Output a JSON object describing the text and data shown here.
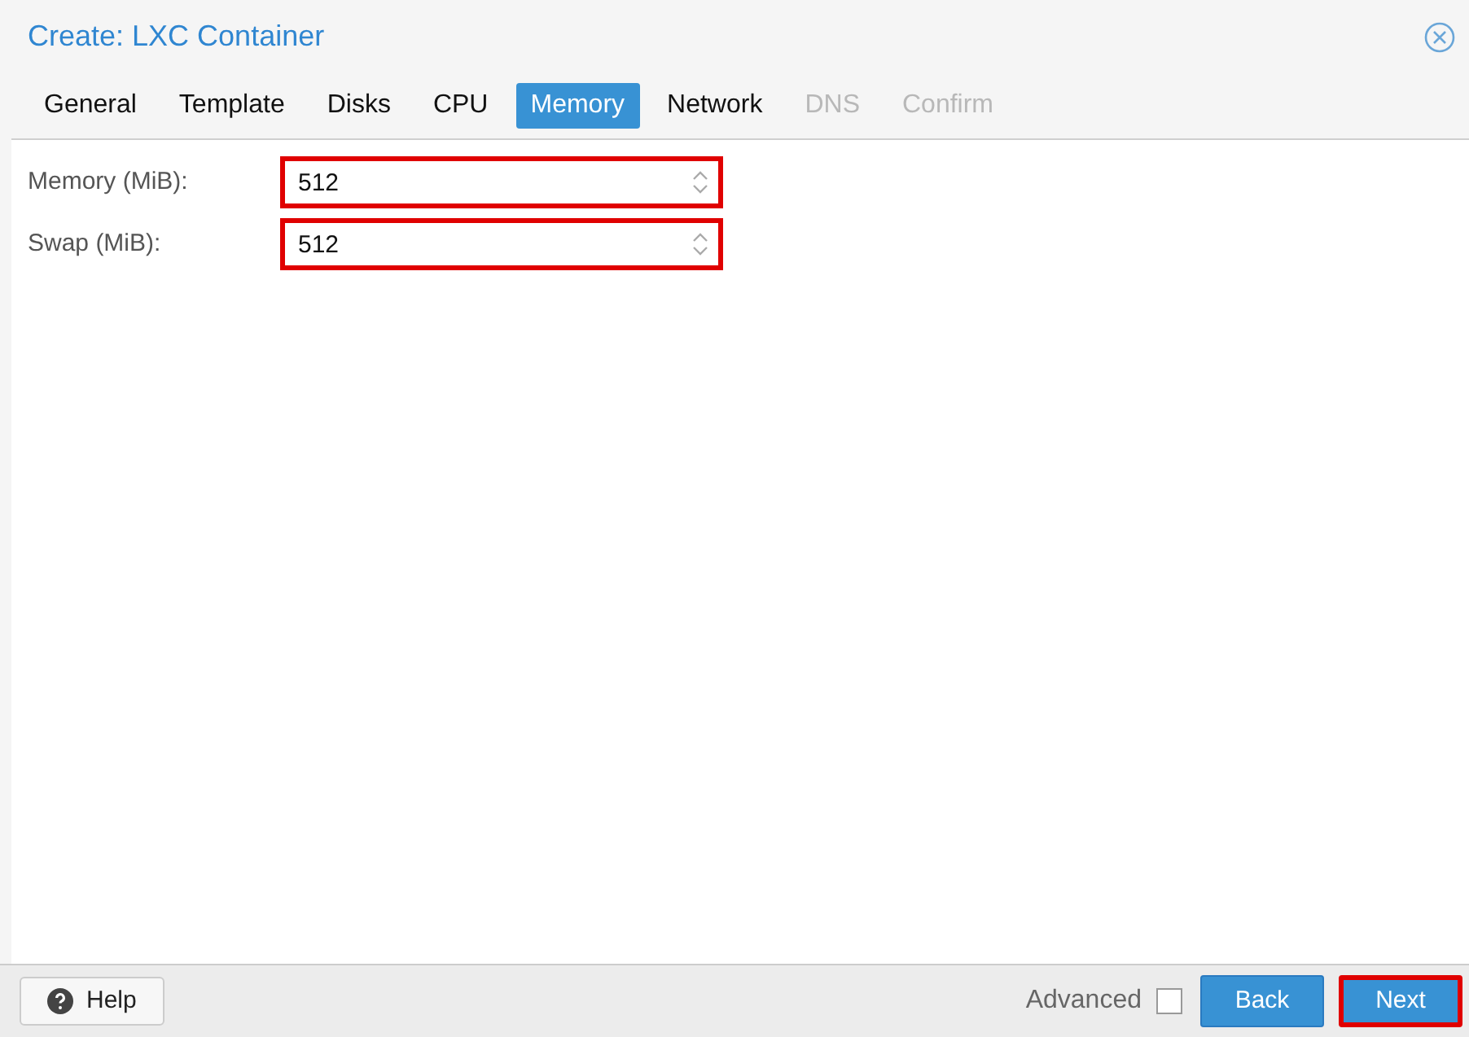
{
  "window": {
    "title": "Create: LXC Container"
  },
  "tabs": [
    {
      "label": "General",
      "selected": false,
      "disabled": false
    },
    {
      "label": "Template",
      "selected": false,
      "disabled": false
    },
    {
      "label": "Disks",
      "selected": false,
      "disabled": false
    },
    {
      "label": "CPU",
      "selected": false,
      "disabled": false
    },
    {
      "label": "Memory",
      "selected": true,
      "disabled": false
    },
    {
      "label": "Network",
      "selected": false,
      "disabled": false
    },
    {
      "label": "DNS",
      "selected": false,
      "disabled": true
    },
    {
      "label": "Confirm",
      "selected": false,
      "disabled": true
    }
  ],
  "fields": [
    {
      "label": "Memory (MiB):",
      "value": "512",
      "highlighted": true
    },
    {
      "label": "Swap (MiB):",
      "value": "512",
      "highlighted": true
    }
  ],
  "footer": {
    "help": "Help",
    "advanced": {
      "label": "Advanced",
      "checked": false
    },
    "buttons": [
      {
        "label": "Back",
        "highlighted": false
      },
      {
        "label": "Next",
        "highlighted": true
      }
    ]
  }
}
